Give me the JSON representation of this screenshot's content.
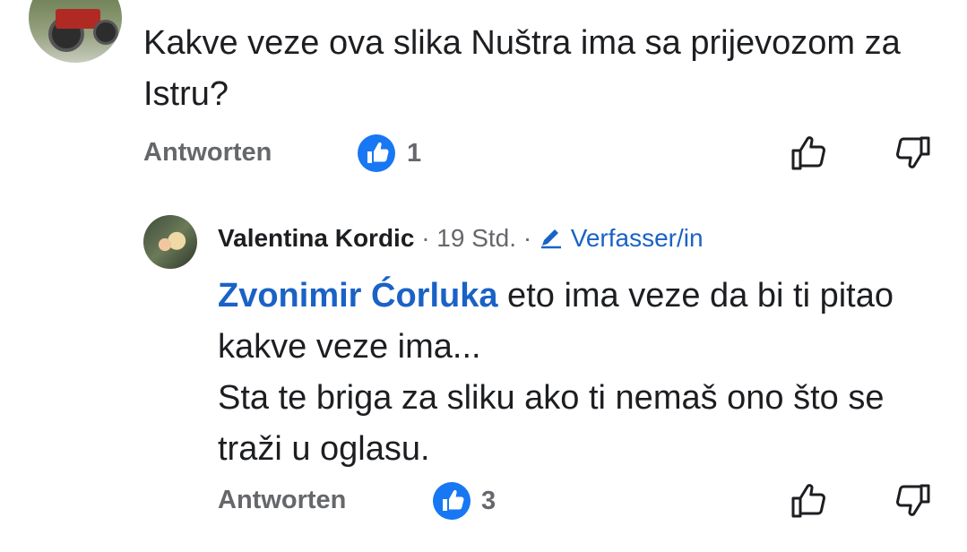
{
  "comment1": {
    "text": "Kakve veze ova slika Nuštra ima sa prijevozom za Istru?",
    "reply_label": "Antworten",
    "like_count": "1"
  },
  "comment2": {
    "author": "Valentina Kordic",
    "separator1": "·",
    "time": "19 Std.",
    "separator2": "·",
    "author_badge": "Verfasser/in",
    "mention": "Zvonimir Ćorluka",
    "text_line1": " eto ima veze da bi ti pitao kakve veze ima...",
    "text_line2": "Sta te briga za sliku ako ti nemaš ono što se traži u oglasu.",
    "reply_label": "Antworten",
    "like_count": "3"
  },
  "icons": {
    "like_badge": "thumbs-up-filled-icon",
    "like_button": "thumbs-up-outline-icon",
    "dislike_button": "thumbs-down-outline-icon",
    "author_badge": "pencil-icon"
  },
  "colors": {
    "mention": "#1a62c6",
    "like_badge": "#1877f2",
    "muted_text": "#65676b",
    "text": "#1c1e21"
  }
}
